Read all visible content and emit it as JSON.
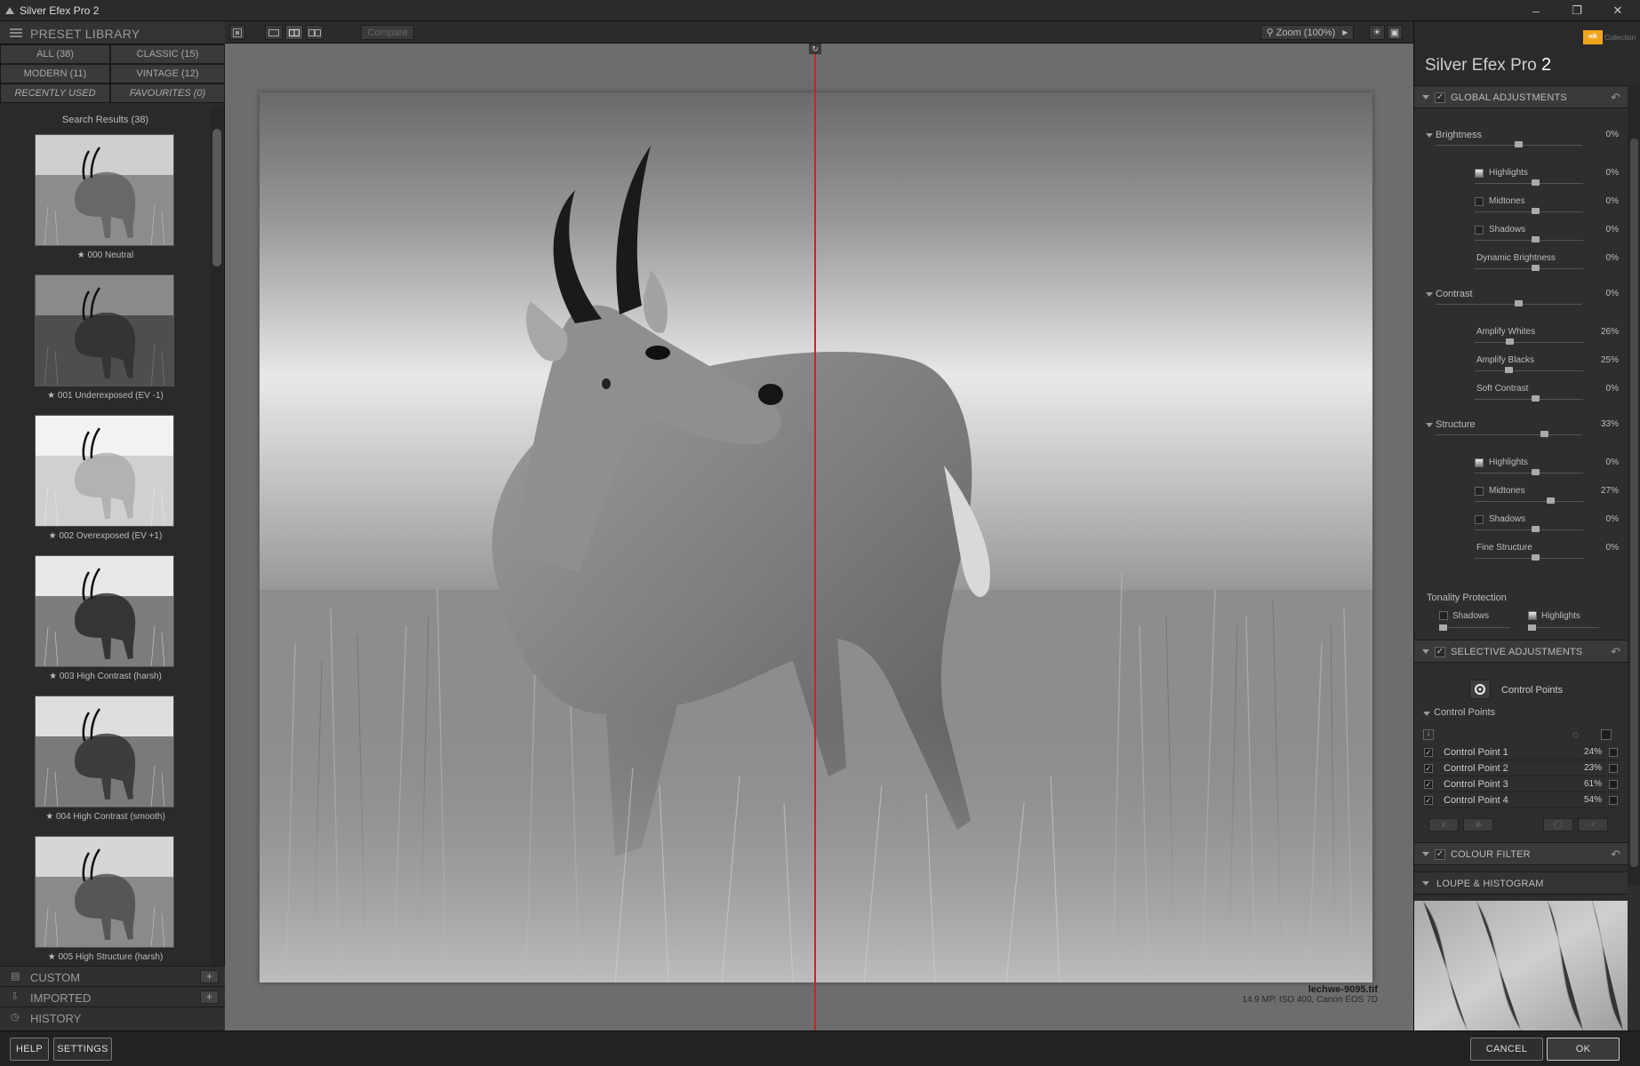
{
  "window": {
    "title": "Silver Efex Pro 2"
  },
  "left_panel": {
    "header": "PRESET LIBRARY",
    "tabs": [
      {
        "label": "ALL (38)"
      },
      {
        "label": "CLASSIC (15)"
      },
      {
        "label": "MODERN (11)"
      },
      {
        "label": "VINTAGE (12)"
      },
      {
        "label": "RECENTLY USED"
      },
      {
        "label": "FAVOURITES (0)"
      }
    ],
    "results_header": "Search Results (38)",
    "presets": [
      {
        "label": "★ 000 Neutral"
      },
      {
        "label": "★ 001 Underexposed (EV -1)"
      },
      {
        "label": "★ 002 Overexposed (EV +1)"
      },
      {
        "label": "★ 003 High Contrast (harsh)"
      },
      {
        "label": "★ 004 High Contrast (smooth)"
      },
      {
        "label": "★ 005 High Structure (harsh)"
      }
    ],
    "sections": [
      {
        "label": "CUSTOM",
        "icon": "folder-icon"
      },
      {
        "label": "IMPORTED",
        "icon": "import-icon"
      },
      {
        "label": "HISTORY",
        "icon": "history-icon"
      }
    ],
    "plus": "+"
  },
  "toolbar": {
    "compare_label": "Compare",
    "zoom_label": "Zoom (100%)"
  },
  "canvas": {
    "file_name": "lechwe-9095.tif",
    "file_meta": "14.9 MP, ISO 400, Canon EOS 7D"
  },
  "right_panel": {
    "brand_prefix": "Silver Efex Pro",
    "brand_version": "2",
    "nik_label": "nik",
    "collection_label": "Collection",
    "global_title": "GLOBAL ADJUSTMENTS",
    "brightness": {
      "label": "Brightness",
      "value": "0%"
    },
    "highlights": {
      "label": "Highlights",
      "value": "0%"
    },
    "midtones": {
      "label": "Midtones",
      "value": "0%"
    },
    "shadows": {
      "label": "Shadows",
      "value": "0%"
    },
    "dynamic_brightness": {
      "label": "Dynamic Brightness",
      "value": "0%"
    },
    "contrast": {
      "label": "Contrast",
      "value": "0%"
    },
    "amplify_whites": {
      "label": "Amplify Whites",
      "value": "26%"
    },
    "amplify_blacks": {
      "label": "Amplify Blacks",
      "value": "25%"
    },
    "soft_contrast": {
      "label": "Soft Contrast",
      "value": "0%"
    },
    "structure": {
      "label": "Structure",
      "value": "33%"
    },
    "s_highlights": {
      "label": "Highlights",
      "value": "0%"
    },
    "s_midtones": {
      "label": "Midtones",
      "value": "27%"
    },
    "s_shadows": {
      "label": "Shadows",
      "value": "0%"
    },
    "fine_structure": {
      "label": "Fine Structure",
      "value": "0%"
    },
    "tonality_title": "Tonality Protection",
    "tonality_shadows": "Shadows",
    "tonality_highlights": "Highlights",
    "selective_title": "SELECTIVE ADJUSTMENTS",
    "control_points_button": "Control Points",
    "control_points_title": "Control Points",
    "control_points": [
      {
        "name": "Control Point 1",
        "value": "24%"
      },
      {
        "name": "Control Point 2",
        "value": "23%"
      },
      {
        "name": "Control Point 3",
        "value": "61%"
      },
      {
        "name": "Control Point 4",
        "value": "54%"
      }
    ],
    "colour_filter_title": "COLOUR FILTER",
    "loupe_title": "LOUPE & HISTOGRAM"
  },
  "bottom": {
    "help": "HELP",
    "settings": "SETTINGS",
    "cancel": "CANCEL",
    "ok": "OK"
  },
  "colors": {
    "accent_line": "#c0282a",
    "nik_orange": "#f0a41d"
  }
}
